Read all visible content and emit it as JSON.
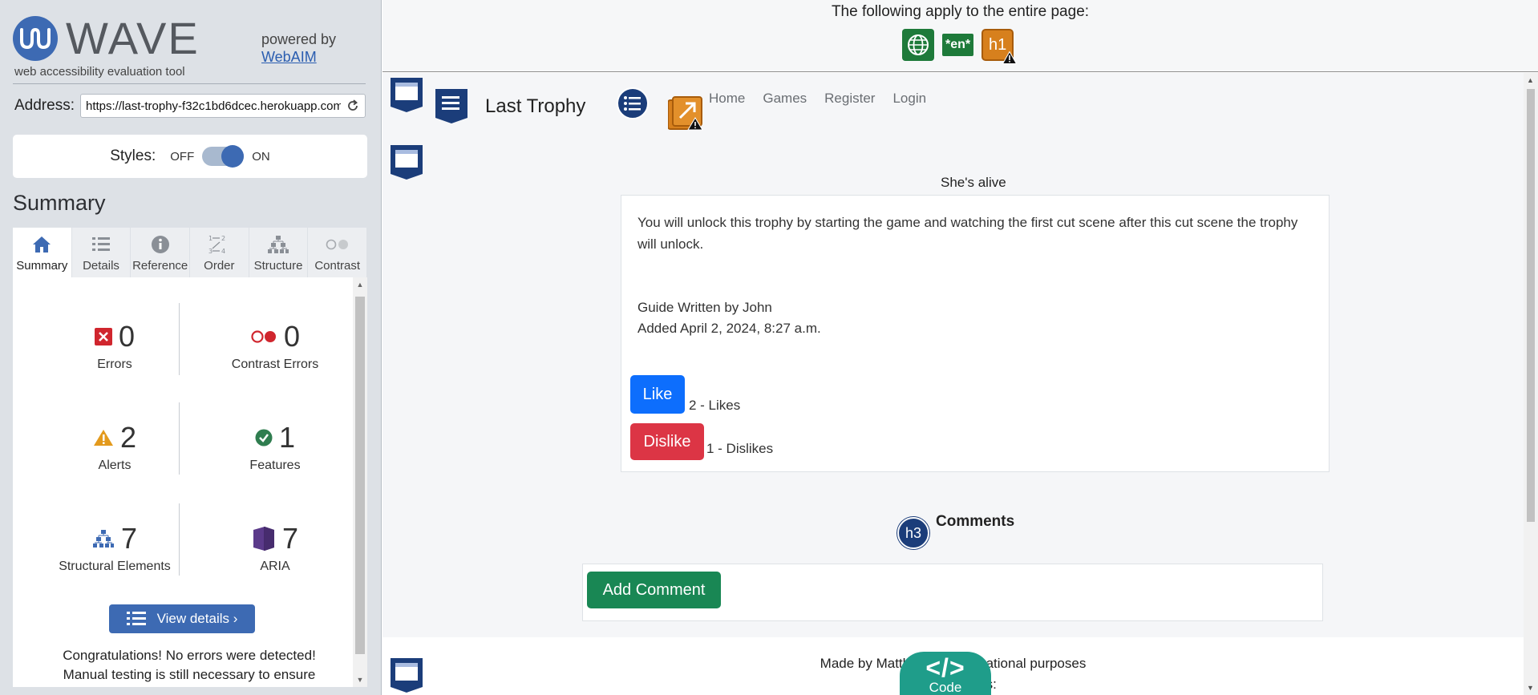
{
  "sidebar": {
    "logo_text": "WAVE",
    "tagline": "web accessibility evaluation tool",
    "powered_by": "powered by",
    "powered_link": "WebAIM",
    "address_label": "Address:",
    "address_value": "https://last-trophy-f32c1bd6dcec.herokuapp.com/",
    "styles_label": "Styles:",
    "styles_off": "OFF",
    "styles_on": "ON",
    "summary_title": "Summary",
    "tabs": [
      {
        "label": "Summary",
        "icon": "home-icon"
      },
      {
        "label": "Details",
        "icon": "list-icon"
      },
      {
        "label": "Reference",
        "icon": "info-icon"
      },
      {
        "label": "Order",
        "icon": "order-icon"
      },
      {
        "label": "Structure",
        "icon": "structure-icon"
      },
      {
        "label": "Contrast",
        "icon": "contrast-icon"
      }
    ],
    "stats": {
      "errors": {
        "count": "0",
        "label": "Errors"
      },
      "contrast_errors": {
        "count": "0",
        "label": "Contrast Errors"
      },
      "alerts": {
        "count": "2",
        "label": "Alerts"
      },
      "features": {
        "count": "1",
        "label": "Features"
      },
      "structural": {
        "count": "7",
        "label": "Structural Elements"
      },
      "aria": {
        "count": "7",
        "label": "ARIA"
      }
    },
    "view_details": "View details ›",
    "congrats_1": "Congratulations! No errors were detected!",
    "congrats_2": "Manual testing is still necessary to ensure"
  },
  "topbar": {
    "text": "The following apply to the entire page:",
    "lang_badge": "*en*",
    "h1_badge": "h1"
  },
  "site": {
    "brand": "Last Trophy",
    "nav": [
      "Home",
      "Games",
      "Register",
      "Login"
    ],
    "guide_title": "She's alive",
    "description": "You will unlock this trophy by starting the game and watching the first cut scene after this cut scene the trophy will unlock.",
    "author": "Guide Written by John",
    "added": "Added April 2, 2024, 8:27 a.m.",
    "like_label": "Like",
    "likes_text": "2 - Likes",
    "dislike_label": "Dislike",
    "dislikes_text": "1 - Dislikes",
    "h3_badge": "h3",
    "comments_heading": "Comments",
    "add_comment": "Add Comment",
    "footer_line1": "Made by Matthe… for Educational purposes",
    "footer_line2": "F… ur socials:",
    "code_label": "Code",
    "code_glyph": "</>"
  },
  "colors": {
    "wave_blue": "#3d6ab3",
    "like_blue": "#0d6efd",
    "dislike_red": "#dc3545",
    "add_green": "#198754",
    "code_teal": "#1f9d8a"
  }
}
